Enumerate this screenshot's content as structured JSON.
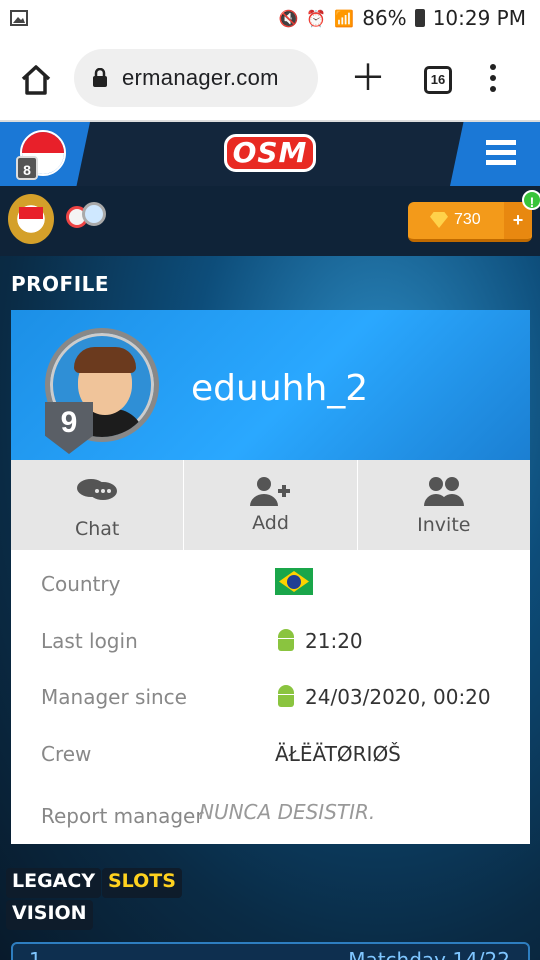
{
  "status_bar": {
    "battery": "86%",
    "time": "10:29 PM"
  },
  "browser": {
    "url": "ermanager.com",
    "tab_count": "16"
  },
  "header": {
    "logo": "OSM",
    "club_level": "8",
    "coins": "730",
    "coins_add": "+",
    "alert": "!"
  },
  "profile": {
    "section_title": "PROFILE",
    "username": "eduuhh_2",
    "level": "9",
    "actions": [
      {
        "label": "Chat"
      },
      {
        "label": "Add"
      },
      {
        "label": "Invite"
      }
    ],
    "rows": {
      "country_label": "Country",
      "last_login_label": "Last login",
      "last_login_value": "21:20",
      "manager_since_label": "Manager since",
      "manager_since_value": "24/03/2020, 00:20",
      "crew_label": "Crew",
      "crew_value": "ÄŁËÄTØRIØŠ"
    },
    "report_label": "Report manager",
    "motto": "NUNCA DESISTIR."
  },
  "tags": [
    "LEGACY",
    "SLOTS",
    "VISION"
  ],
  "match": {
    "number": "1",
    "label": "Matchday 14/22"
  }
}
